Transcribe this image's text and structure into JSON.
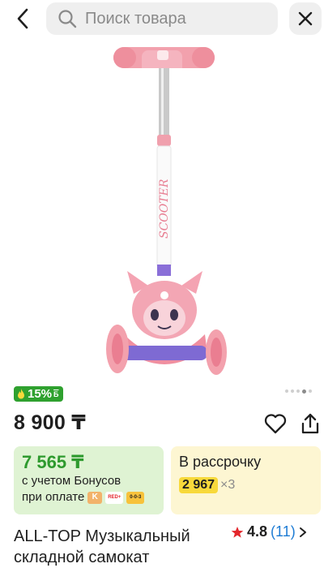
{
  "header": {
    "back_icon": "chevron-left-icon",
    "search_placeholder": "Поиск товара",
    "search_icon": "search-icon",
    "close_icon": "close-icon"
  },
  "product": {
    "image_alt": "pink kids scooter with character head",
    "image_print": "SCOOTER",
    "cashback": {
      "percent": "15%",
      "unit": "Б",
      "icon": "fire-icon",
      "color": "#2fa12f"
    },
    "gallery_dots": {
      "count": 5,
      "active": 4
    },
    "price": "8 900 ₸",
    "title": "ALL-TOP Музыкальный складной самокат",
    "rating": {
      "value": "4.8",
      "count": "(11)",
      "icon": "star-icon",
      "star_color": "#e3262b"
    }
  },
  "actions": {
    "favorite_icon": "heart-icon",
    "share_icon": "share-icon"
  },
  "bonus_card": {
    "price": "7 565 ₸",
    "line1": "с учетом Бонусов",
    "line2": "при оплате",
    "payment_logos": [
      "Kaspi",
      "RED+",
      "0-0-3"
    ],
    "accent": "#2e9a2e",
    "background": "#dff3d3"
  },
  "installment_card": {
    "title": "В рассрочку",
    "amount": "2 967",
    "multiplier": "×3",
    "highlight": "#f8d93b",
    "background": "#fdf6d2"
  }
}
